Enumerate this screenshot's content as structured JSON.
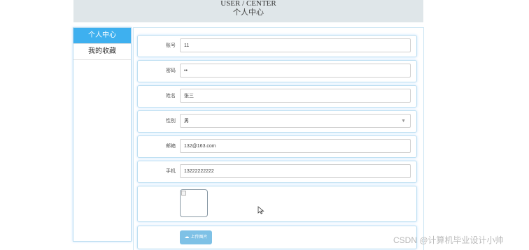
{
  "header": {
    "title_en": "USER / CENTER",
    "title_zh": "个人中心"
  },
  "sidebar": {
    "items": [
      {
        "label": "个人中心",
        "active": true
      },
      {
        "label": "我的收藏",
        "active": false
      }
    ]
  },
  "form": {
    "account": {
      "label": "账号",
      "value": "11"
    },
    "password": {
      "label": "密码",
      "value": "••"
    },
    "name": {
      "label": "姓名",
      "value": "张三"
    },
    "gender": {
      "label": "性别",
      "value": "男"
    },
    "email": {
      "label": "邮箱",
      "value": "132@163.com"
    },
    "phone": {
      "label": "手机",
      "value": "13222222222"
    },
    "upload": {
      "label": "上传图片"
    }
  },
  "watermark": "CSDN @计算机毕业设计小帅",
  "colors": {
    "accent": "#3eb0ef",
    "header_bg": "#dfe6e9",
    "upload_btn": "#7ec1e6"
  }
}
